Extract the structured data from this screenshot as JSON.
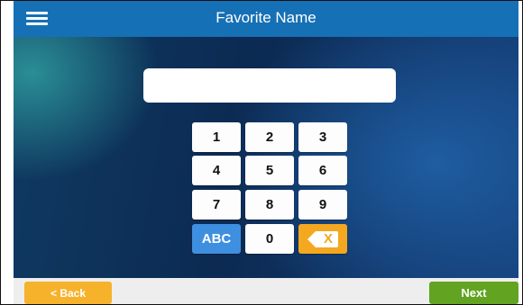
{
  "header": {
    "title": "Favorite Name",
    "menu_icon": "hamburger-menu-icon"
  },
  "name_input": {
    "value": "",
    "placeholder": ""
  },
  "keypad": {
    "k1": "1",
    "k2": "2",
    "k3": "3",
    "k4": "4",
    "k5": "5",
    "k6": "6",
    "k7": "7",
    "k8": "8",
    "k9": "9",
    "abc": "ABC",
    "k0": "0",
    "backspace_glyph": "X",
    "backspace_icon": "backspace-icon"
  },
  "footer": {
    "back_label": "< Back",
    "next_label": "Next"
  },
  "colors": {
    "header": "#1670b5",
    "abc_key": "#3f8fe0",
    "backspace_key": "#f3a81f",
    "back_button": "#f6b22b",
    "next_button": "#62a321"
  }
}
